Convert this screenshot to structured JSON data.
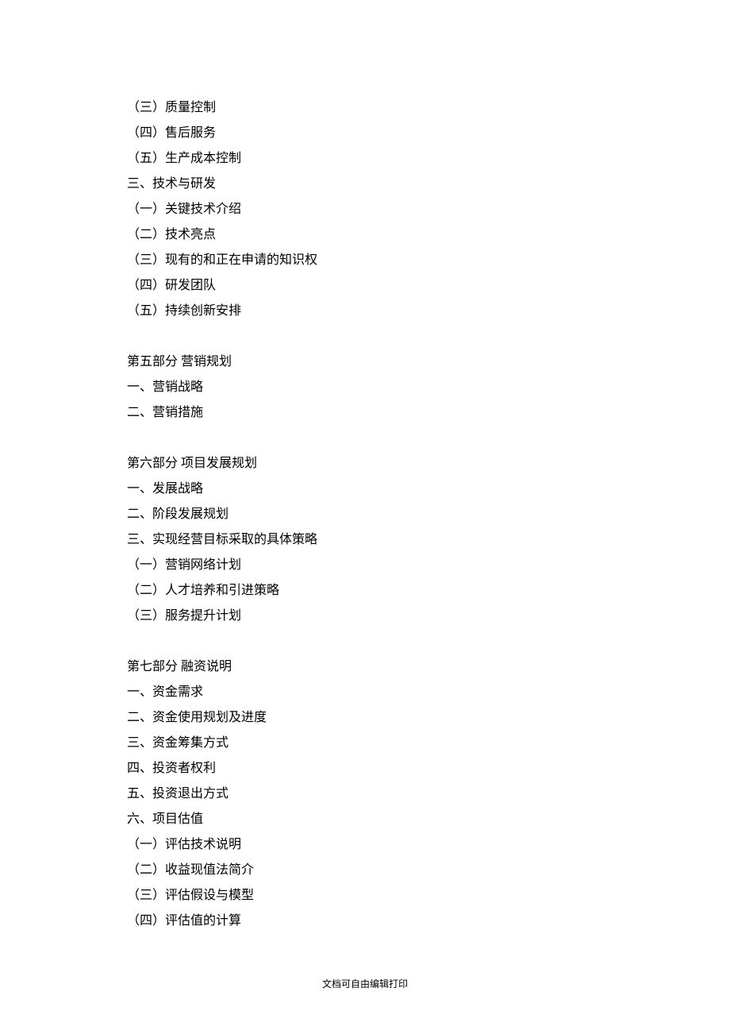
{
  "lines": [
    "（三）质量控制",
    "（四）售后服务",
    "（五）生产成本控制",
    "三、技术与研发",
    "（一）关键技术介绍",
    "（二）技术亮点",
    "（三）现有的和正在申请的知识权",
    "（四）研发团队",
    "（五）持续创新安排",
    "",
    "第五部分  营销规划",
    "一、营销战略",
    "二、营销措施",
    "",
    "第六部分  项目发展规划",
    "一、发展战略",
    "二、阶段发展规划",
    "三、实现经营目标采取的具体策略",
    "（一）营销网络计划",
    "（二）人才培养和引进策略",
    "（三）服务提升计划",
    "",
    "第七部分  融资说明",
    "一、资金需求",
    "二、资金使用规划及进度",
    "三、资金筹集方式",
    "四、投资者权利",
    "五、投资退出方式",
    "六、项目估值",
    "（一）评估技术说明",
    "（二）收益现值法简介",
    "（三）评估假设与模型",
    "（四）评估值的计算"
  ],
  "footer": "文档可自由编辑打印"
}
